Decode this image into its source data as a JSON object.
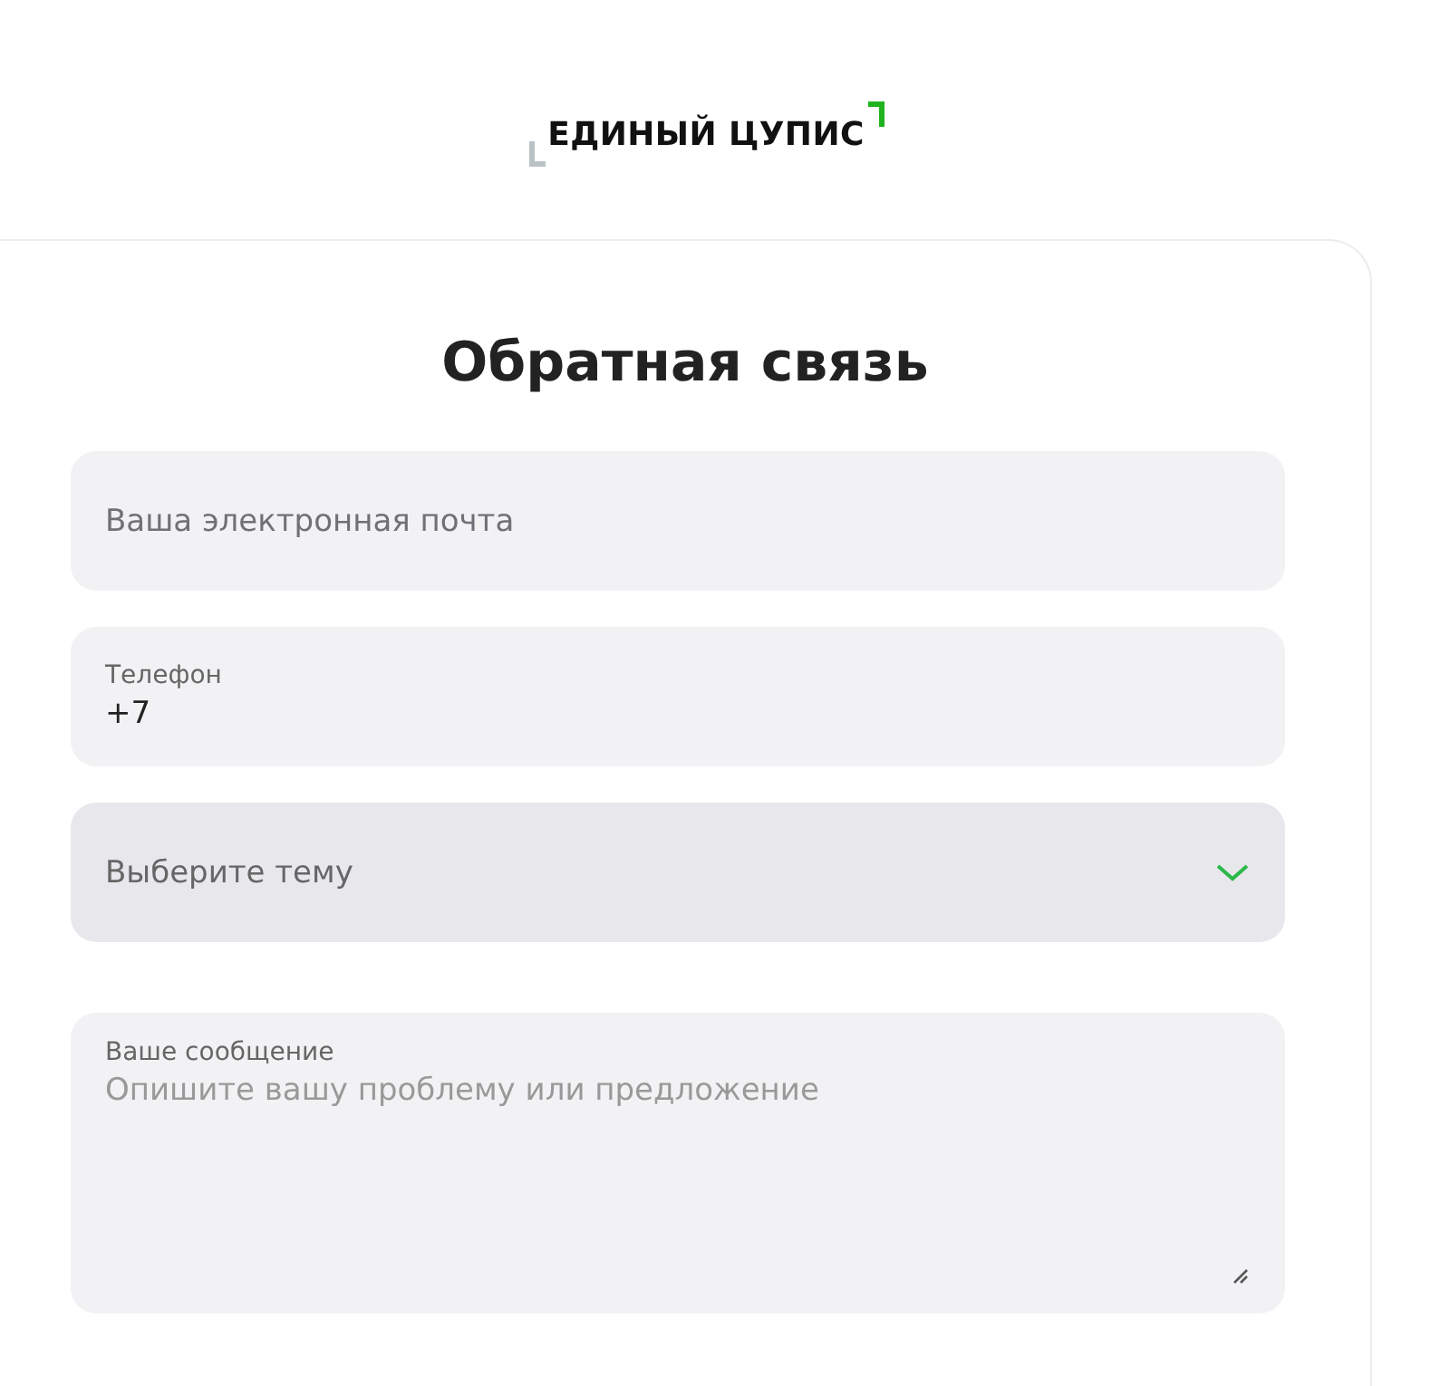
{
  "logo": {
    "text": "ЕДИНЫЙ ЦУПИС"
  },
  "form": {
    "title": "Обратная связь",
    "fields": [
      {
        "kind": "input",
        "placeholder": "Ваша электронная почта"
      },
      {
        "kind": "labeled",
        "label": "Телефон",
        "value": "+7"
      },
      {
        "kind": "select",
        "placeholder": "Выберите тему"
      },
      {
        "kind": "textarea",
        "label": "Ваше сообщение",
        "placeholder": "Опишите вашу проблему или предложение"
      }
    ]
  }
}
